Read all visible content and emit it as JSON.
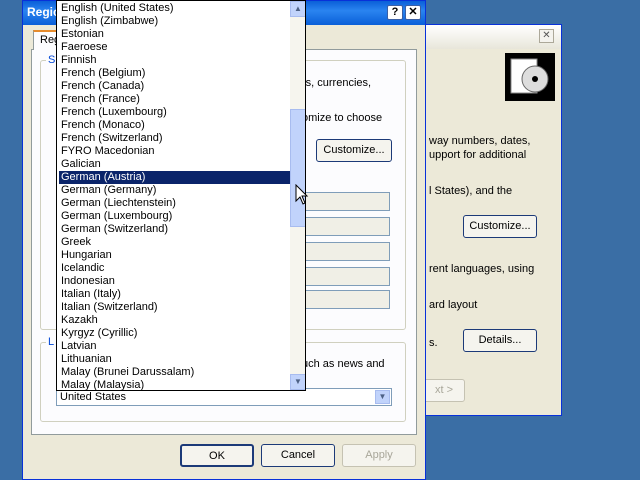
{
  "back_dialog": {
    "close_glyph": "✕",
    "text_lines": [
      "way numbers, dates,",
      "upport for additional",
      "l States), and the",
      "rent languages, using",
      "ard layout",
      "s."
    ],
    "customize_label": "Customize...",
    "details_label": "Details...",
    "next_label": "xt >"
  },
  "front_dialog": {
    "title": "Regio",
    "help_glyph": "?",
    "close_glyph": "✕",
    "tab_label": "Reg",
    "group_letter_1": "S",
    "group_letter_2": "L",
    "partial_lines": [
      "rs, currencies,",
      "omize to choose",
      "uch as news and"
    ],
    "customize_label": "Customize...",
    "ok_label": "OK",
    "cancel_label": "Cancel",
    "apply_label": "Apply"
  },
  "language_list": {
    "selected_index": 13,
    "items": [
      "English (United States)",
      "English (Zimbabwe)",
      "Estonian",
      "Faeroese",
      "Finnish",
      "French (Belgium)",
      "French (Canada)",
      "French (France)",
      "French (Luxembourg)",
      "French (Monaco)",
      "French (Switzerland)",
      "FYRO Macedonian",
      "Galician",
      "German (Austria)",
      "German (Germany)",
      "German (Liechtenstein)",
      "German (Luxembourg)",
      "German (Switzerland)",
      "Greek",
      "Hungarian",
      "Icelandic",
      "Indonesian",
      "Italian (Italy)",
      "Italian (Switzerland)",
      "Kazakh",
      "Kyrgyz (Cyrillic)",
      "Latvian",
      "Lithuanian",
      "Malay (Brunei Darussalam)",
      "Malay (Malaysia)"
    ]
  },
  "location_combo": {
    "value": "United States"
  },
  "icons": {
    "scroll_up": "▲",
    "scroll_down": "▼",
    "combo_arrow": "▼"
  }
}
